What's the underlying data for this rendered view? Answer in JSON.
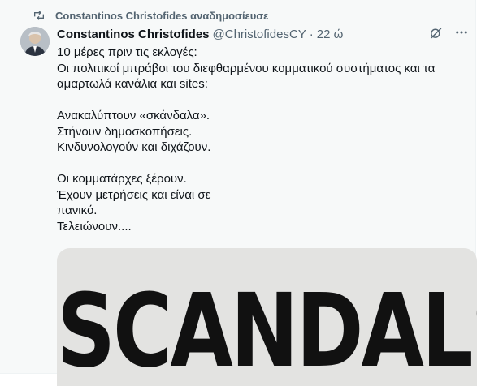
{
  "repost": {
    "text": "Constantinos Christofides αναδημοσίευσε"
  },
  "tweet": {
    "author_name": "Constantinos Christofides",
    "author_handle": "@ChristofidesCY",
    "separator": "·",
    "timestamp": "22 ώ",
    "lines": [
      "10 μέρες πριν τις εκλογές:",
      "Οι πολιτικοί μπράβοι του διεφθαρμένου κομματικού συστήματος και τα",
      "αμαρτωλά κανάλια και sites:",
      "",
      "Ανακαλύπτουν «σκάνδαλα».",
      "Στήνουν δημοσκοπήσεις.",
      "Κινδυνολογούν και διχάζουν.",
      "",
      "Οι κομματάρχες ξέρουν.",
      "Έχουν μετρήσεις και είναι σε",
      "πανικό.",
      "Τελειώνουν...."
    ],
    "media_text": "SCANDALS"
  },
  "icons": {
    "repost": "repost-icon",
    "grok": "grok-icon",
    "more": "more-icon"
  },
  "colors": {
    "muted": "#536471",
    "text": "#0f1419"
  }
}
